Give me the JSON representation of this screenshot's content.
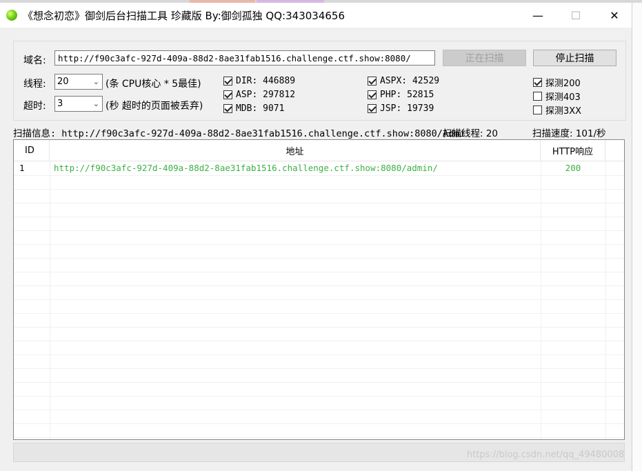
{
  "window": {
    "title": "《想念初恋》御剑后台扫描工具 珍藏版 By:御剑孤独 QQ:343034656",
    "min": "—",
    "max": "☐",
    "close": "✕"
  },
  "form": {
    "domain_label": "域名:",
    "domain_value": "http://f90c3afc-927d-409a-88d2-8ae31fab1516.challenge.ctf.show:8080/",
    "scanning_button": "正在扫描",
    "stop_button": "停止扫描",
    "threads_label": "线程:",
    "threads_value": "20",
    "threads_hint": "(条 CPU核心 * 5最佳)",
    "timeout_label": "超时:",
    "timeout_value": "3",
    "timeout_hint": "(秒 超时的页面被丢弃)"
  },
  "dictionaries": [
    {
      "label": "DIR: 446889",
      "checked": true
    },
    {
      "label": "ASP: 297812",
      "checked": true
    },
    {
      "label": "MDB: 9071",
      "checked": true
    },
    {
      "label": "ASPX: 42529",
      "checked": true
    },
    {
      "label": "PHP: 52815",
      "checked": true
    },
    {
      "label": "JSP: 19739",
      "checked": true
    }
  ],
  "probes": [
    {
      "label": "探测200",
      "checked": true
    },
    {
      "label": "探测403",
      "checked": false
    },
    {
      "label": "探测3XX",
      "checked": false
    }
  ],
  "status": {
    "scan_info": "扫描信息: http://f90c3afc-927d-409a-88d2-8ae31fab1516.challenge.ctf.show:8080/Admi",
    "scan_threads": "扫描线程: 20",
    "scan_speed": "扫描速度: 101/秒"
  },
  "table": {
    "columns": [
      "ID",
      "地址",
      "HTTP响应"
    ],
    "rows": [
      {
        "id": "1",
        "url": "http://f90c3afc-927d-409a-88d2-8ae31fab1516.challenge.ctf.show:8080/admin/",
        "code": "200"
      }
    ]
  },
  "watermark": "https://blog.csdn.net/qq_49480008",
  "colors": {
    "success_green": "#3cb043",
    "window_bg": "#f0f0f0"
  }
}
